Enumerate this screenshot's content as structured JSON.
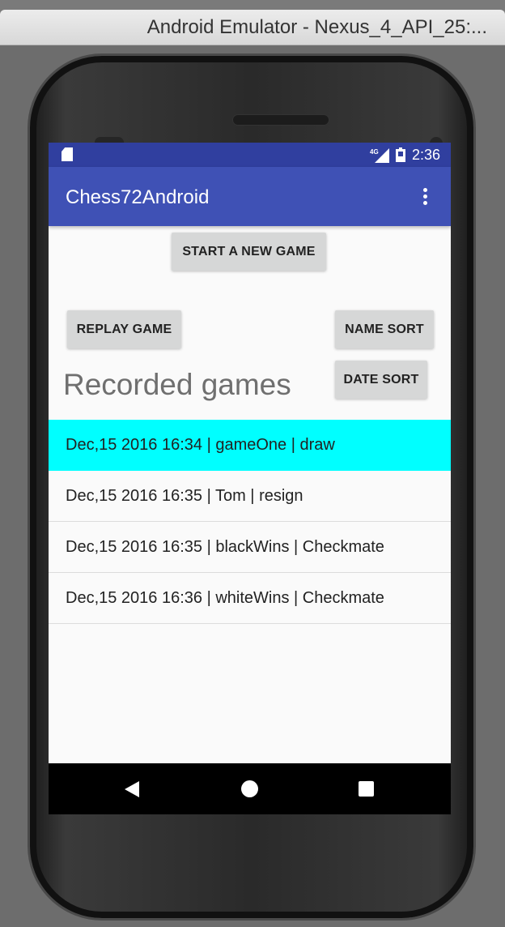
{
  "window": {
    "title": "Android Emulator - Nexus_4_API_25:..."
  },
  "statusbar": {
    "time": "2:36",
    "network": "4G",
    "icons": [
      "sd-card-icon",
      "signal-icon",
      "battery-icon"
    ]
  },
  "appbar": {
    "title": "Chess72Android",
    "menu_icon": "overflow-menu-icon"
  },
  "buttons": {
    "new_game": "START A NEW GAME",
    "replay": "REPLAY GAME",
    "name_sort": "NAME SORT",
    "date_sort": "DATE SORT"
  },
  "section": {
    "title": "Recorded games"
  },
  "games": [
    {
      "label": "Dec,15 2016 16:34 | gameOne | draw",
      "selected": true
    },
    {
      "label": "Dec,15 2016 16:35 | Tom | resign",
      "selected": false
    },
    {
      "label": "Dec,15 2016 16:35 | blackWins | Checkmate",
      "selected": false
    },
    {
      "label": "Dec,15 2016 16:36 | whiteWins | Checkmate",
      "selected": false
    }
  ],
  "colors": {
    "statusbar": "#303f9f",
    "appbar": "#3f51b5",
    "selected_row": "#00ffff",
    "button": "#d6d7d7"
  },
  "navbar": {
    "icons": [
      "back-icon",
      "home-icon",
      "recents-icon"
    ]
  }
}
